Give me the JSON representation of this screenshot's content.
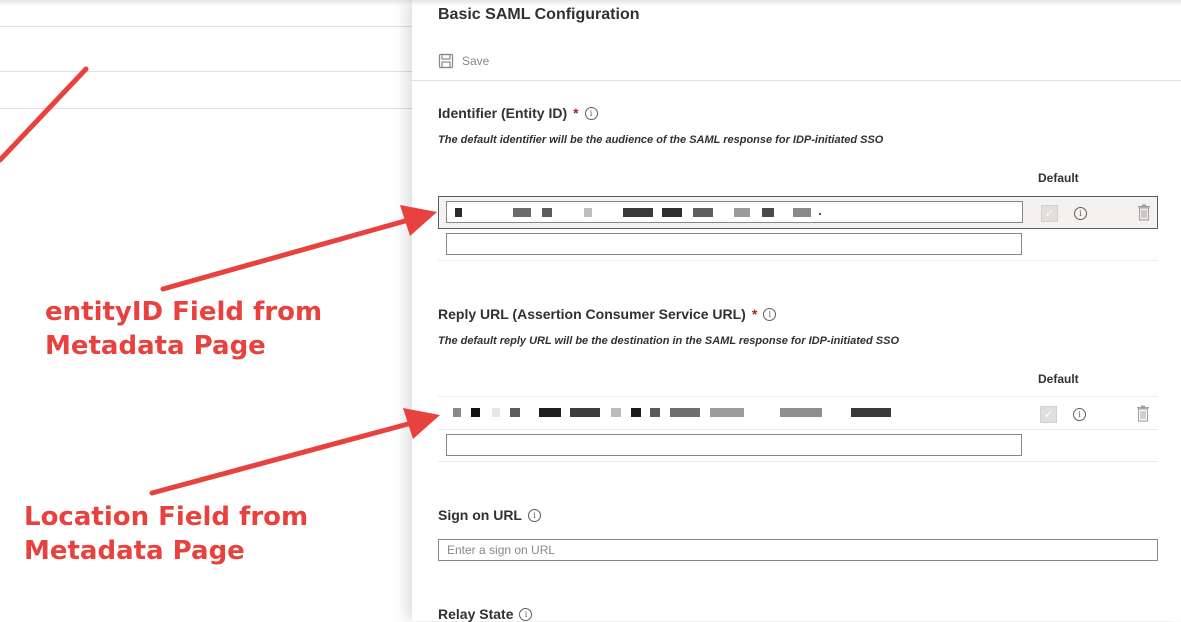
{
  "blade": {
    "title": "Basic SAML Configuration",
    "toolbar": {
      "save_label": "Save",
      "save_icon": "save-icon"
    }
  },
  "identifier": {
    "label": "Identifier (Entity ID)",
    "required_mark": "*",
    "hint": "The default identifier will be the audience of the SAML response for IDP-initiated SSO",
    "column_header": "Default",
    "value": "",
    "value_redacted": true,
    "empty_value": ""
  },
  "reply_url": {
    "label": "Reply URL (Assertion Consumer Service URL)",
    "required_mark": "*",
    "hint": "The default reply URL will be the destination in the SAML response for IDP-initiated SSO",
    "column_header": "Default",
    "value": "",
    "value_redacted": true,
    "empty_value": ""
  },
  "sign_on": {
    "label": "Sign on URL",
    "value": "",
    "placeholder": "Enter a sign on URL"
  },
  "relay_state": {
    "label": "Relay State"
  },
  "annotations": {
    "entity_id_line1": "entityID Field from",
    "entity_id_line2": "Metadata Page",
    "location_line1": "Location Field from",
    "location_line2": "Metadata Page",
    "color": "#e8423f"
  },
  "colors": {
    "required": "#a4262c",
    "text": "#323130",
    "muted": "#8a8886"
  }
}
